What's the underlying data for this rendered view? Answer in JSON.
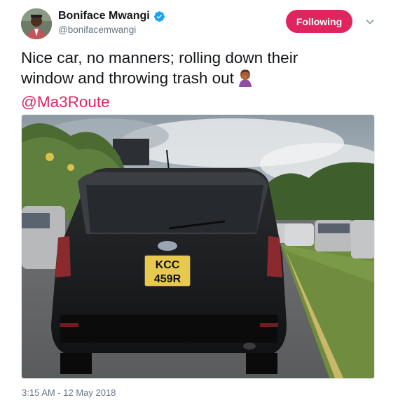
{
  "author": {
    "display_name": "Boniface Mwangi",
    "handle": "@bonifacemwangi",
    "verified": true
  },
  "follow_button_label": "Following",
  "tweet": {
    "text_line1": "Nice car, no manners; rolling down their",
    "text_line2": "window and throwing trash out",
    "emoji": "person-facepalming-icon",
    "mention": "@Ma3Route"
  },
  "photo": {
    "plate_line1": "KCC",
    "plate_line2": "459R"
  },
  "timestamp": "3:15 AM - 12 May 2018",
  "colors": {
    "accent": "#e0245e",
    "verified": "#1da1f2",
    "text": "#14171a",
    "secondary": "#657786"
  }
}
